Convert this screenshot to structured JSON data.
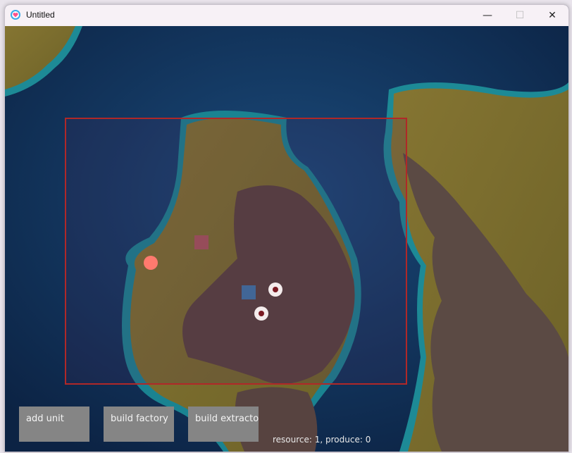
{
  "window": {
    "title": "Untitled"
  },
  "controls": {
    "minimize_glyph": "—",
    "maximize_glyph": "☐",
    "close_glyph": "✕"
  },
  "colors": {
    "ocean_deep": "#0e2b52",
    "ocean_shallow": "#1b7a8c",
    "land": "#7a6a2a",
    "mountain": "#5a423c",
    "selection_border": "#b02828",
    "button_bg": "#858585",
    "unit_player": "#ff7a6e",
    "factory": "#9a4a5e",
    "extractor": "#3f6aa0",
    "enemy_unit_ring": "#f4ecec",
    "enemy_unit_core": "#7a1a22"
  },
  "buttons": {
    "add_unit": "add unit",
    "build_factory": "build factory",
    "build_extractor": "build extractor"
  },
  "status": {
    "text": "resource: 1, produce: 0"
  }
}
